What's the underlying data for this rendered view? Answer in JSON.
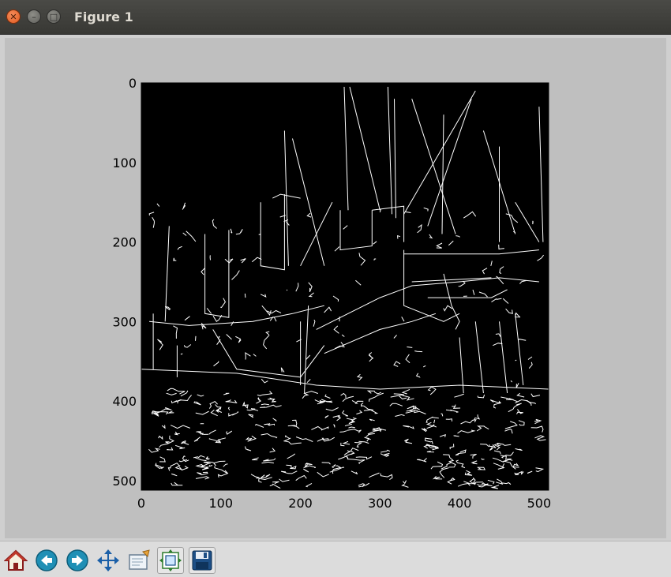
{
  "window": {
    "title": "Figure 1",
    "buttons": [
      "close",
      "minimize",
      "maximize"
    ]
  },
  "toolbar": {
    "tools": [
      {
        "name": "home-button",
        "icon": "home-icon"
      },
      {
        "name": "back-button",
        "icon": "back-arrow-icon"
      },
      {
        "name": "forward-button",
        "icon": "forward-arrow-icon"
      },
      {
        "name": "pan-button",
        "icon": "pan-arrows-icon"
      },
      {
        "name": "zoom-button",
        "icon": "zoom-rect-icon"
      },
      {
        "name": "subplots-button",
        "icon": "subplots-config-icon"
      },
      {
        "name": "save-button",
        "icon": "floppy-disk-icon"
      }
    ]
  },
  "chart_data": {
    "type": "image",
    "description_of_content": "",
    "xlim": [
      0,
      512
    ],
    "ylim": [
      512,
      0
    ],
    "x_ticks": [
      0,
      100,
      200,
      300,
      400,
      500
    ],
    "y_ticks": [
      0,
      100,
      200,
      300,
      400,
      500
    ],
    "colors": {
      "background": "#000000",
      "edges": "#ffffff",
      "figure_bg": "#bfbfbf"
    }
  }
}
